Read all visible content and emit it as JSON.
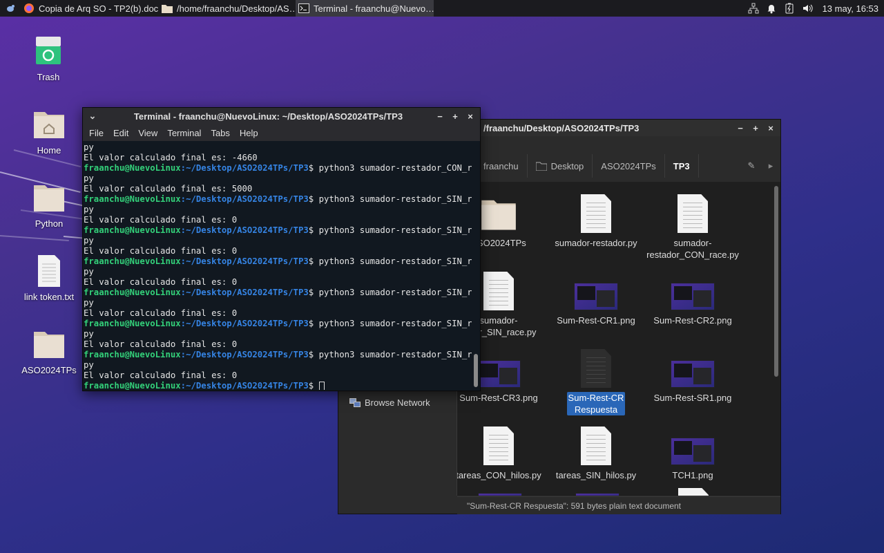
{
  "panel": {
    "tasks": [
      {
        "label": "Copia de Arq SO - TP2(b).doc…",
        "icon": "firefox-icon"
      },
      {
        "label": "/home/fraanchu/Desktop/AS…",
        "icon": "folder-icon"
      },
      {
        "label": "Terminal - fraanchu@Nuevo…",
        "icon": "terminal-icon"
      }
    ],
    "clock": "13 may, 16:53"
  },
  "desktop": {
    "icons": [
      {
        "label": "Trash"
      },
      {
        "label": "Home"
      },
      {
        "label": "Python"
      },
      {
        "label": "link token.txt"
      },
      {
        "label": "ASO2024TPs"
      }
    ]
  },
  "terminal": {
    "title": "Terminal - fraanchu@NuevoLinux: ~/Desktop/ASO2024TPs/TP3",
    "menu": [
      "File",
      "Edit",
      "View",
      "Terminal",
      "Tabs",
      "Help"
    ],
    "prompt_user": "fraanchu@NuevoLinux",
    "prompt_path": ":~/Desktop/ASO2024TPs/TP3",
    "prompt_end": "$ ",
    "lines": [
      {
        "kind": "out",
        "text": "py"
      },
      {
        "kind": "out",
        "text": "El valor calculado final es: -4660"
      },
      {
        "kind": "cmd",
        "text": "python3 sumador-restador_CON_race."
      },
      {
        "kind": "out",
        "text": "py"
      },
      {
        "kind": "out",
        "text": "El valor calculado final es: 5000"
      },
      {
        "kind": "cmd",
        "text": "python3 sumador-restador_SIN_race."
      },
      {
        "kind": "out",
        "text": "py"
      },
      {
        "kind": "out",
        "text": "El valor calculado final es: 0"
      },
      {
        "kind": "cmd",
        "text": "python3 sumador-restador_SIN_race."
      },
      {
        "kind": "out",
        "text": "py"
      },
      {
        "kind": "out",
        "text": "El valor calculado final es: 0"
      },
      {
        "kind": "cmd",
        "text": "python3 sumador-restador_SIN_race."
      },
      {
        "kind": "out",
        "text": "py"
      },
      {
        "kind": "out",
        "text": "El valor calculado final es: 0"
      },
      {
        "kind": "cmd",
        "text": "python3 sumador-restador_SIN_race."
      },
      {
        "kind": "out",
        "text": "py"
      },
      {
        "kind": "out",
        "text": "El valor calculado final es: 0"
      },
      {
        "kind": "cmd",
        "text": "python3 sumador-restador_SIN_race."
      },
      {
        "kind": "out",
        "text": "py"
      },
      {
        "kind": "out",
        "text": "El valor calculado final es: 0"
      },
      {
        "kind": "cmd",
        "text": "python3 sumador-restador_SIN_race."
      },
      {
        "kind": "out",
        "text": "py"
      },
      {
        "kind": "out",
        "text": "El valor calculado final es: 0"
      },
      {
        "kind": "prompt",
        "text": ""
      }
    ]
  },
  "filemanager": {
    "title": "/fraanchu/Desktop/ASO2024TPs/TP3",
    "breadcrumbs": [
      "fraanchu",
      "Desktop",
      "ASO2024TPs",
      "TP3"
    ],
    "sidebar_network": "Browse Network",
    "items": [
      {
        "label": "ASO2024TPs",
        "kind": "folder"
      },
      {
        "label": "sumador-restador.py",
        "kind": "doc"
      },
      {
        "label": "sumador-\nrestador_CON_race.py",
        "kind": "doc"
      },
      {
        "label": "sumador-\nrador_SIN_race.py",
        "kind": "doc"
      },
      {
        "label": "Sum-Rest-CR1.png",
        "kind": "image"
      },
      {
        "label": "Sum-Rest-CR2.png",
        "kind": "image"
      },
      {
        "label": "Sum-Rest-CR3.png",
        "kind": "image"
      },
      {
        "label": "Sum-Rest-CR\nRespuesta",
        "kind": "doc-dark",
        "selected": true
      },
      {
        "label": "Sum-Rest-SR1.png",
        "kind": "image"
      },
      {
        "label": "tareas_CON_hilos.py",
        "kind": "doc"
      },
      {
        "label": "tareas_SIN_hilos.py",
        "kind": "doc"
      },
      {
        "label": "TCH1.png",
        "kind": "image"
      }
    ],
    "status": "\"Sum-Rest-CR Respuesta\": 591 bytes plain text document"
  },
  "colors": {
    "prompt_user": "#33d17a",
    "prompt_path": "#3584e4",
    "selection": "#2a67b8"
  }
}
